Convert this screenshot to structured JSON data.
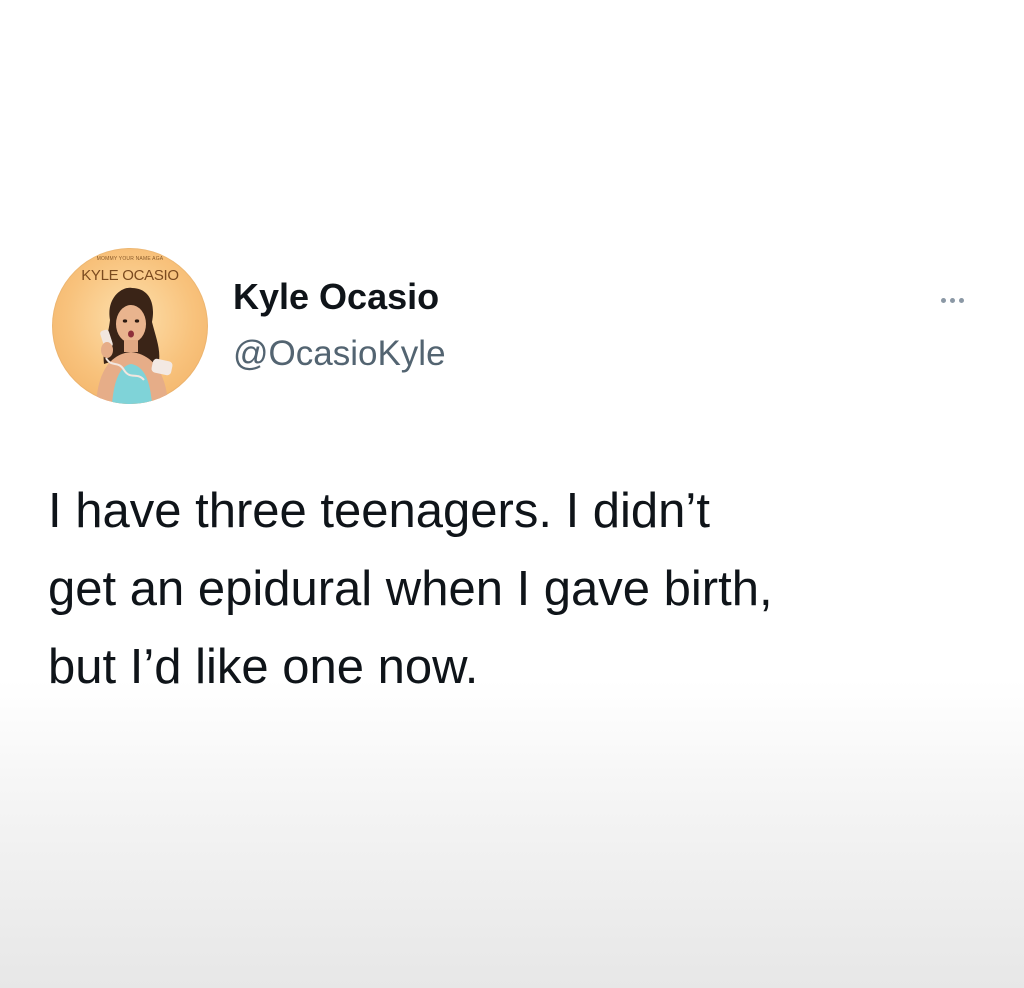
{
  "author": {
    "display_name": "Kyle Ocasio",
    "handle": "@OcasioKyle",
    "avatar": {
      "tagline": "MOMMY YOUR NAME AGA",
      "name": "KYLE OCASIO",
      "background_color": "#f8c27c"
    }
  },
  "menu": {
    "icon": "more-horizontal-icon"
  },
  "tweet": {
    "lines": [
      "I have three teenagers. I didn’t",
      "get an epidural when I gave birth,",
      "but I’d like one now."
    ]
  },
  "colors": {
    "text_primary": "#0f1419",
    "text_secondary": "#536471"
  }
}
